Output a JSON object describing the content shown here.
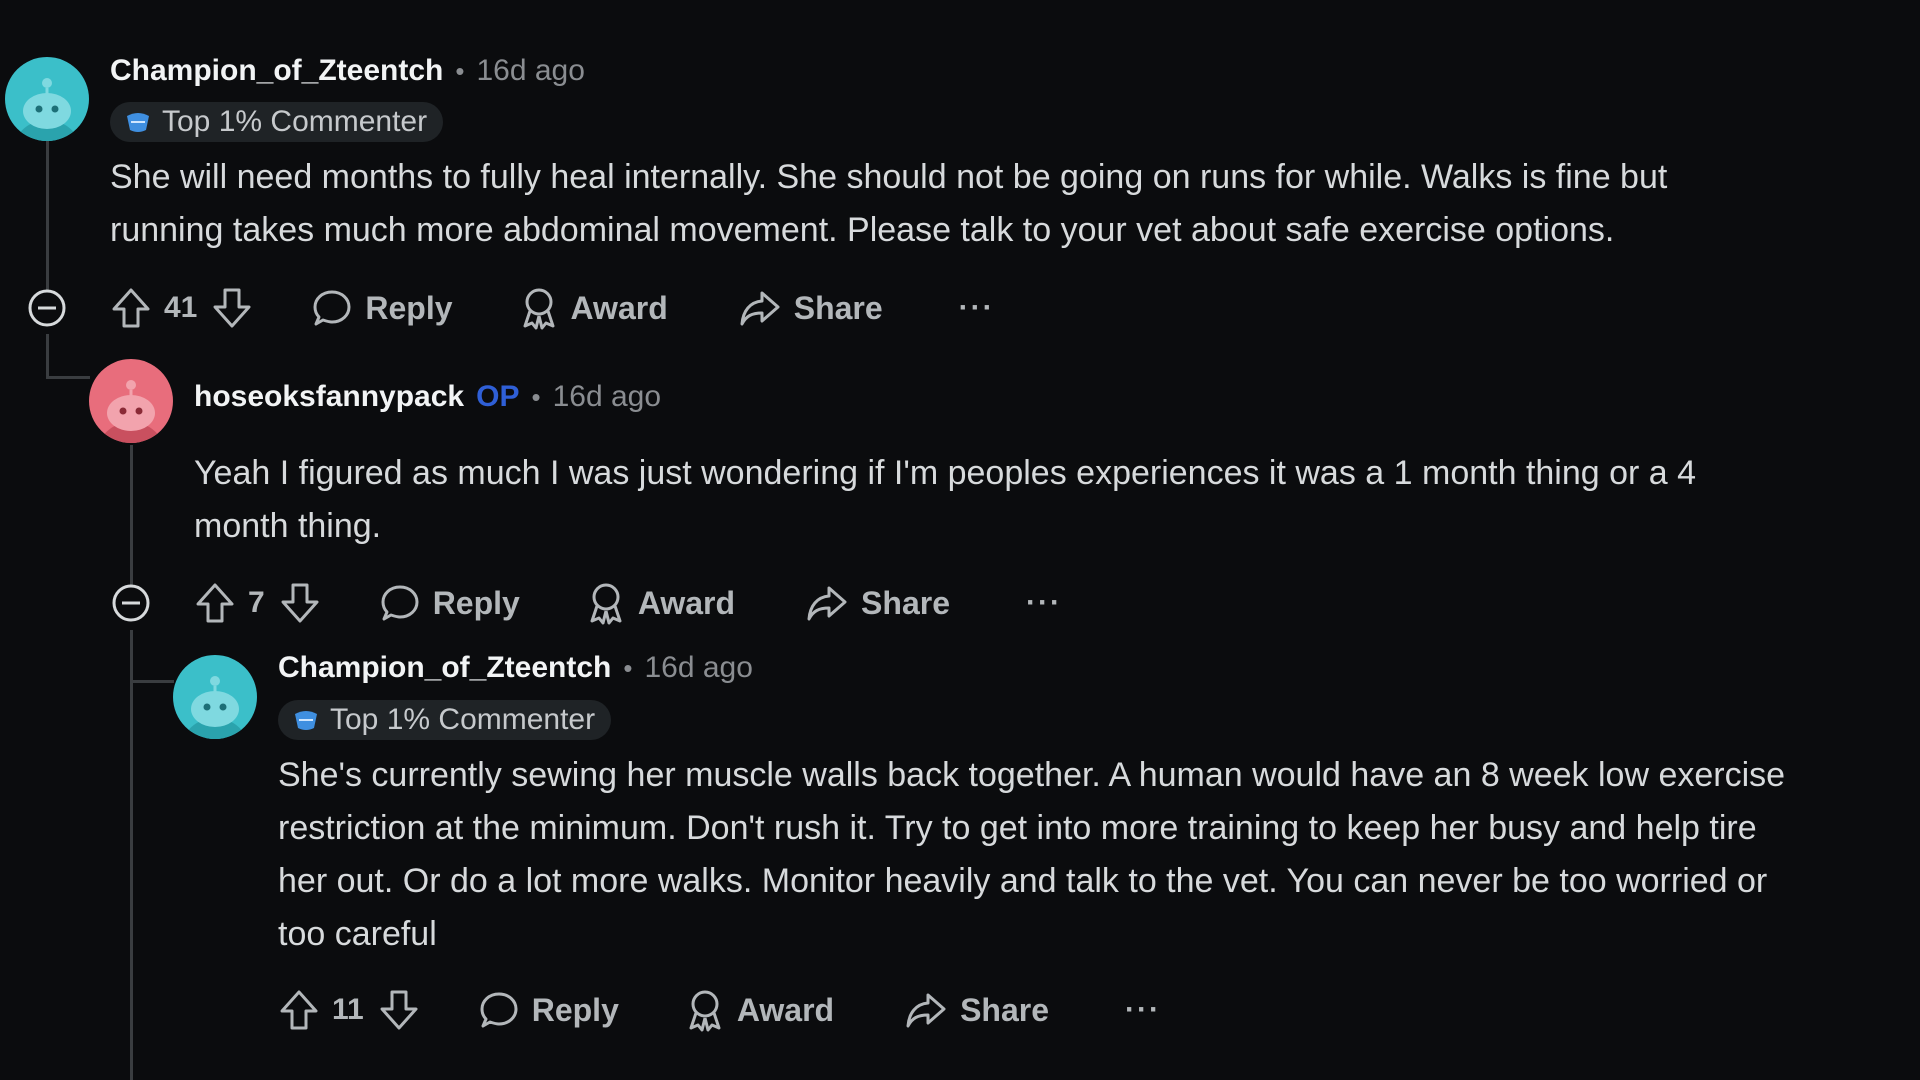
{
  "colors": {
    "background": "#0b0c0e",
    "text": "#d7dadc",
    "muted": "#8a8d91",
    "op": "#2f5fd6",
    "avatar_teal": "#3bbfc9",
    "avatar_pink": "#e86d7c"
  },
  "comments": [
    {
      "username": "Champion_of_Zteentch",
      "separator": "•",
      "timestamp": "16d ago",
      "flair": "Top 1% Commenter",
      "body_line1": "She will need months to fully heal internally. She should not be going on runs for while. Walks is fine but",
      "body_line2": "running takes much more abdominal movement. Please talk to your vet about safe exercise options.",
      "score": "41",
      "reply_label": "Reply",
      "award_label": "Award",
      "share_label": "Share",
      "more_label": "···",
      "avatar_icon": "snoo-avatar-icon"
    },
    {
      "username": "hoseoksfannypack",
      "op_tag": "OP",
      "separator": "•",
      "timestamp": "16d ago",
      "body_line1": "Yeah I figured as much I was just wondering if I'm peoples experiences it was a 1 month thing or a 4",
      "body_line2": "month thing.",
      "score": "7",
      "reply_label": "Reply",
      "award_label": "Award",
      "share_label": "Share",
      "more_label": "···",
      "avatar_icon": "snoo-avatar-icon"
    },
    {
      "username": "Champion_of_Zteentch",
      "separator": "•",
      "timestamp": "16d ago",
      "flair": "Top 1% Commenter",
      "body_line1": "She's currently sewing her muscle walls back together. A human would have an 8 week low exercise",
      "body_line2": "restriction at the minimum. Don't rush it. Try to get into more training to keep her busy and help tire",
      "body_line3": "her out. Or do a lot more walks. Monitor heavily and talk to the vet. You can never be too worried or",
      "body_line4": "too careful",
      "score": "11",
      "reply_label": "Reply",
      "award_label": "Award",
      "share_label": "Share",
      "more_label": "···",
      "avatar_icon": "snoo-avatar-icon"
    }
  ]
}
